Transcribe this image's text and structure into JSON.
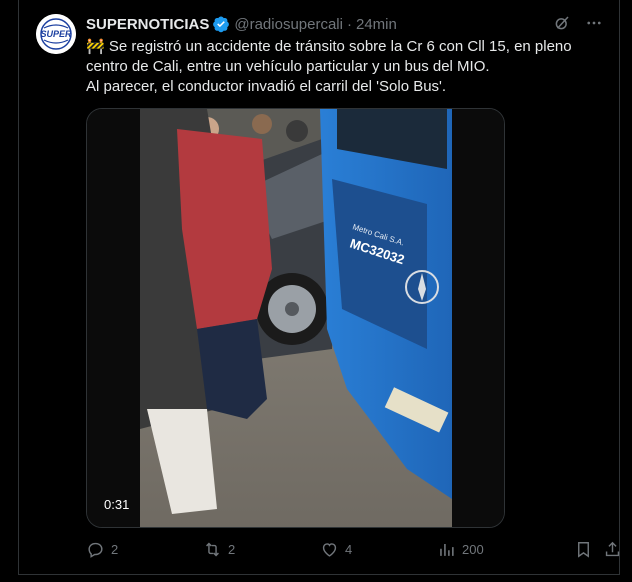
{
  "tweet": {
    "display_name": "SUPERNOTICIAS",
    "handle": "@radiosupercali",
    "separator": "·",
    "time": "24min",
    "avatar_text": "SUPER",
    "emoji": "🚧",
    "text_lines": [
      " Se registró un accidente de tránsito sobre la Cr 6 con Cll 15, en pleno",
      "centro de Cali, entre un vehículo particular y un bus del MIO.",
      "Al parecer,  el conductor invadió el carril del 'Solo Bus'."
    ],
    "video": {
      "duration": "0:31",
      "bus_plate": "MC32032",
      "bus_text": "Metro Cali S.A."
    },
    "actions": {
      "replies": "2",
      "reposts": "2",
      "likes": "4",
      "views": "200"
    }
  },
  "colors": {
    "background": "#000000",
    "text": "#e7e9ea",
    "muted": "#71767b",
    "verified": "#1d9bf0",
    "border": "#2f3336"
  }
}
